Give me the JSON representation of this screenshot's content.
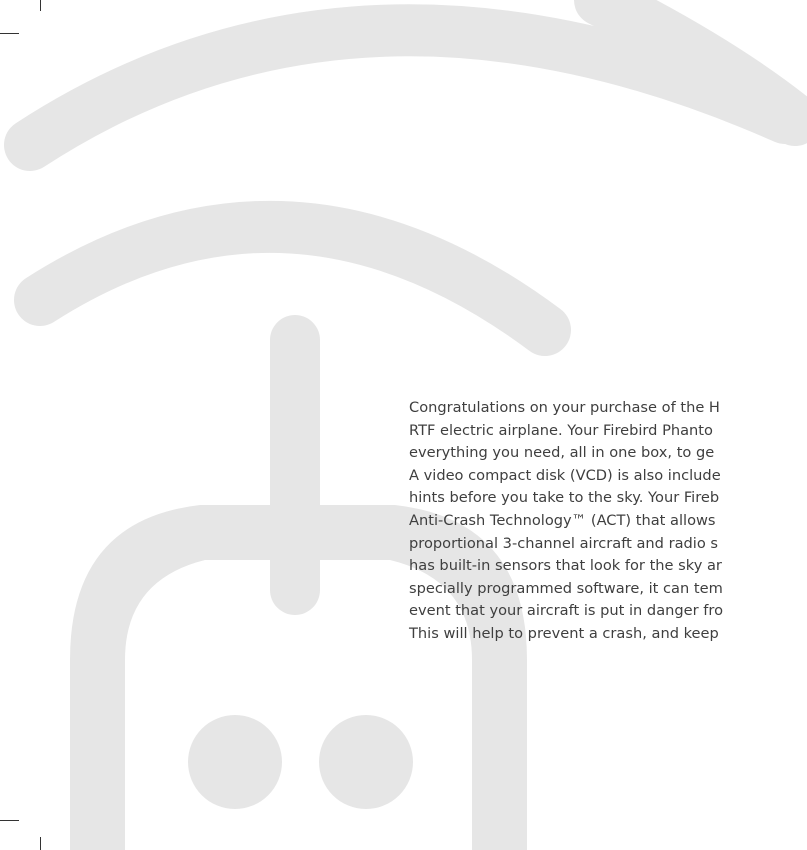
{
  "colors": {
    "background": "#ffffff",
    "graphic": "#e6e6e6",
    "text": "#3f3f3f",
    "crop_marks": "#333333"
  },
  "graphic": {
    "icon": "radio-transmitter-signal-icon"
  },
  "intro": {
    "lines": [
      "Congratulations on your purchase of the H",
      "RTF electric airplane. Your Firebird Phanto",
      "everything you need, all in one box, to ge",
      "A video compact disk (VCD) is also include",
      "hints before you take to the sky. Your Fireb",
      "Anti-Crash Technology™ (ACT) that allows",
      "proportional 3-channel aircraft and radio s",
      "has built-in sensors that look for the sky ar",
      "specially programmed software, it can tem",
      "event that your aircraft is put in danger fro",
      "This will help to prevent a crash, and keep"
    ]
  }
}
